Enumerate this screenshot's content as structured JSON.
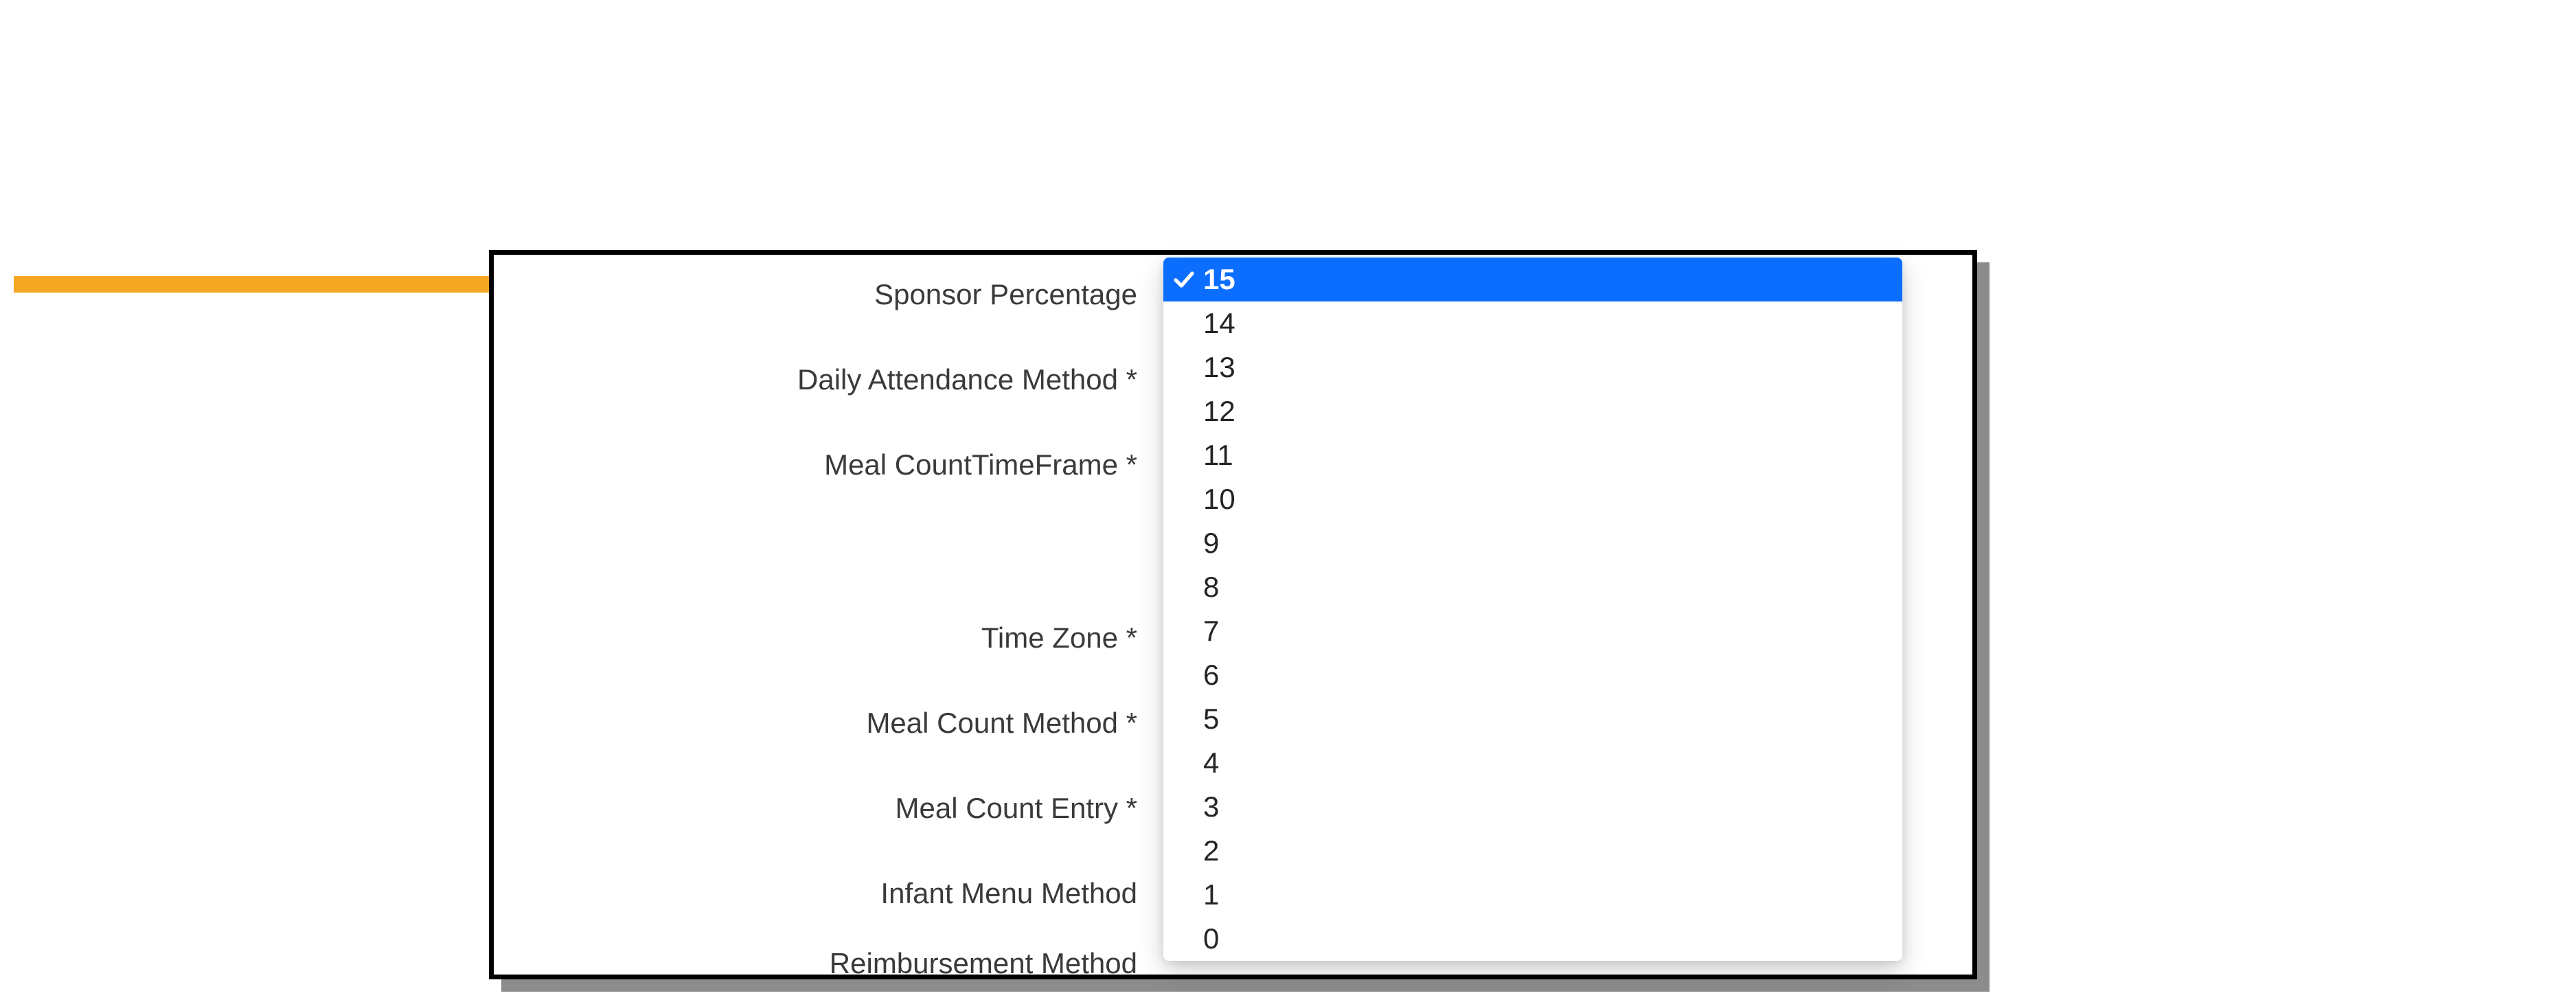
{
  "annotation": {
    "target_field": "sponsor_percentage"
  },
  "form": {
    "fields": {
      "sponsor_percentage": {
        "label": "Sponsor Percentage"
      },
      "daily_attendance": {
        "label": "Daily Attendance Method *"
      },
      "meal_count_timeframe": {
        "label": "Meal CountTimeFrame *"
      },
      "time_zone": {
        "label": "Time Zone *"
      },
      "meal_count_method": {
        "label": "Meal Count Method *"
      },
      "meal_count_entry": {
        "label": "Meal Count Entry *"
      },
      "infant_menu_method": {
        "label": "Infant Menu Method"
      },
      "reimbursement_method": {
        "label": "Reimbursement Method"
      }
    },
    "sponsor_percentage_dropdown": {
      "selected": "15",
      "options": [
        "15",
        "14",
        "13",
        "12",
        "11",
        "10",
        "9",
        "8",
        "7",
        "6",
        "5",
        "4",
        "3",
        "2",
        "1",
        "0"
      ]
    }
  },
  "colors": {
    "accent_arrow": "#F5A623",
    "select_highlight": "#0b6eff"
  }
}
